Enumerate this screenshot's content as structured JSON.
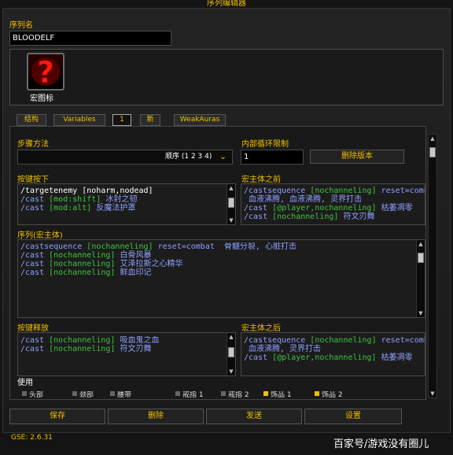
{
  "window": {
    "title": "序列编辑器"
  },
  "sequence": {
    "name_label": "序列名",
    "name_value": "BLOODELF",
    "icon_label": "宏图标",
    "icon_glyph": "?"
  },
  "tabs": [
    {
      "label": "结构",
      "active": false
    },
    {
      "label": "Variables",
      "active": false
    },
    {
      "label": "1",
      "active": true
    },
    {
      "label": "新",
      "active": false
    },
    {
      "label": "WeakAuras",
      "active": false
    }
  ],
  "step": {
    "label": "步骤方法",
    "value": "顺序 (1 2 3 4)"
  },
  "loop": {
    "label": "内部循环限制",
    "value": "1",
    "delete_version_label": "删除版本"
  },
  "keypress": {
    "label": "按键按下",
    "lines": [
      [
        {
          "t": "/targetenemy [noharm,nodead]",
          "c": "w"
        }
      ],
      [
        {
          "t": "/cast ",
          "c": "c"
        },
        {
          "t": "[mod:shift]",
          "c": "g"
        },
        {
          "t": " 冰封之韧",
          "c": "c"
        }
      ],
      [
        {
          "t": "/cast ",
          "c": "c"
        },
        {
          "t": "[mod:alt]",
          "c": "g"
        },
        {
          "t": " 反魔法护罩",
          "c": "c"
        }
      ]
    ]
  },
  "pre_macro": {
    "label": "宏主体之前",
    "lines": [
      [
        {
          "t": "/castsequence ",
          "c": "c"
        },
        {
          "t": "[nochanneling]",
          "c": "g"
        },
        {
          "t": " reset=combat",
          "c": "c"
        }
      ],
      [
        {
          "t": " 血液沸腾, 血液沸腾, 灵界打击",
          "c": "c"
        }
      ],
      [
        {
          "t": "/cast ",
          "c": "c"
        },
        {
          "t": "[@player,nochanneling]",
          "c": "g"
        },
        {
          "t": " 枯萎凋零",
          "c": "c"
        }
      ],
      [
        {
          "t": "/cast ",
          "c": "c"
        },
        {
          "t": "[nochanneling]",
          "c": "g"
        },
        {
          "t": " 符文刃舞",
          "c": "c"
        }
      ]
    ]
  },
  "sequence_body": {
    "label": "序列(宏主体)",
    "lines": [
      [
        {
          "t": "/castsequence ",
          "c": "c"
        },
        {
          "t": "[nochanneling]",
          "c": "g"
        },
        {
          "t": " reset=combat ",
          "c": "c"
        },
        {
          "t": " 骨髓分裂, 心脏打击",
          "c": "c"
        }
      ],
      [
        {
          "t": "/cast ",
          "c": "c"
        },
        {
          "t": "[nochanneling]",
          "c": "g"
        },
        {
          "t": " 白骨风暴",
          "c": "c"
        }
      ],
      [
        {
          "t": "/cast ",
          "c": "c"
        },
        {
          "t": "[nochanneling]",
          "c": "g"
        },
        {
          "t": " 艾泽拉斯之心精华",
          "c": "c"
        }
      ],
      [
        {
          "t": "/cast ",
          "c": "c"
        },
        {
          "t": "[nochanneling]",
          "c": "g"
        },
        {
          "t": " 鲜血印记",
          "c": "c"
        }
      ]
    ]
  },
  "keyrelease": {
    "label": "按键释放",
    "lines": [
      [
        {
          "t": "/cast ",
          "c": "c"
        },
        {
          "t": "[nochanneling]",
          "c": "g"
        },
        {
          "t": " 吸血鬼之血",
          "c": "c"
        }
      ],
      [
        {
          "t": "/cast ",
          "c": "c"
        },
        {
          "t": "[nochanneling]",
          "c": "g"
        },
        {
          "t": " 符文刃舞",
          "c": "c"
        }
      ]
    ]
  },
  "post_macro": {
    "label": "宏主体之后",
    "lines": [
      [
        {
          "t": "/castsequence ",
          "c": "c"
        },
        {
          "t": "[nochanneling]",
          "c": "g"
        },
        {
          "t": " reset=combat",
          "c": "c"
        }
      ],
      [
        {
          "t": " 血液沸腾, 灵界打击",
          "c": "c"
        }
      ],
      [
        {
          "t": "/cast ",
          "c": "c"
        },
        {
          "t": "[@player,nochanneling]",
          "c": "g"
        },
        {
          "t": " 枯萎凋零",
          "c": "c"
        }
      ]
    ]
  },
  "use": {
    "label": "使用",
    "items": [
      {
        "label": "头部",
        "checked": false
      },
      {
        "label": "颈部",
        "checked": false
      },
      {
        "label": "腰带",
        "checked": false
      },
      {
        "label": "戒指 1",
        "checked": false
      },
      {
        "label": "戒指 2",
        "checked": false
      },
      {
        "label": "饰品 1",
        "checked": true
      },
      {
        "label": "饰品 2",
        "checked": true
      }
    ]
  },
  "buttons": {
    "save": "保存",
    "delete": "删除",
    "send": "发送",
    "settings": "设置"
  },
  "version": "GSE: 2.6.31",
  "watermark": "百家号/游戏没有圈儿",
  "colors": {
    "gold": "#f0c000",
    "command": "#8ea0ff",
    "condition": "#3ec43e",
    "plain": "#ffffff"
  }
}
